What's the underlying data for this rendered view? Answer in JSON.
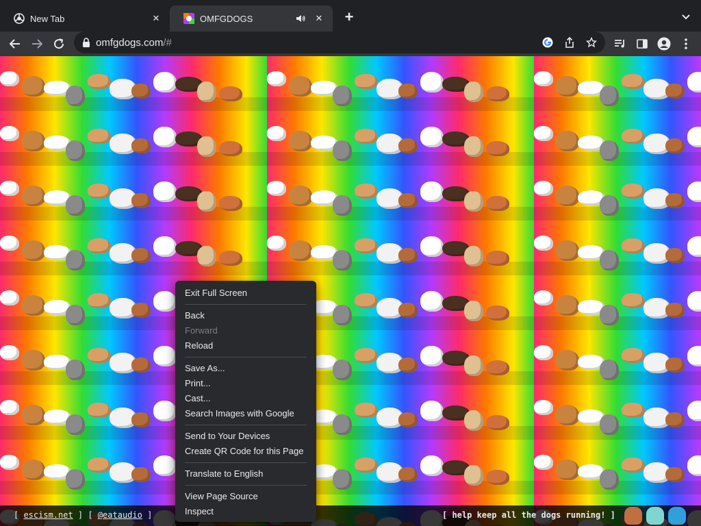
{
  "tabs": [
    {
      "title": "New Tab",
      "active": false,
      "favicon": "chrome-icon"
    },
    {
      "title": "OMFGDOGS",
      "active": true,
      "favicon": "dogs-favicon-icon",
      "audio": true
    }
  ],
  "toolbar": {
    "url_host": "omfgdogs.com",
    "url_path": "/#"
  },
  "footer": {
    "open1": "[ ",
    "link1": "escism.net",
    "mid": " ] [ ",
    "link2": "@eataudio",
    "close": " ]",
    "right_text": "[ help keep all the dogs running! ]"
  },
  "context_menu": {
    "items": [
      {
        "label": "Exit Full Screen"
      },
      {
        "label": "Back"
      },
      {
        "label": "Forward",
        "disabled": true
      },
      {
        "label": "Reload"
      },
      {
        "label": "Save As..."
      },
      {
        "label": "Print..."
      },
      {
        "label": "Cast..."
      },
      {
        "label": "Search Images with Google"
      },
      {
        "label": "Send to Your Devices"
      },
      {
        "label": "Create QR Code for this Page"
      },
      {
        "label": "Translate to English"
      },
      {
        "label": "View Page Source"
      },
      {
        "label": "Inspect"
      }
    ]
  },
  "colors": {
    "tab_bg": "#202124",
    "toolbar_bg": "#35363a",
    "menu_bg": "#292a2d",
    "text": "#e8eaed"
  }
}
